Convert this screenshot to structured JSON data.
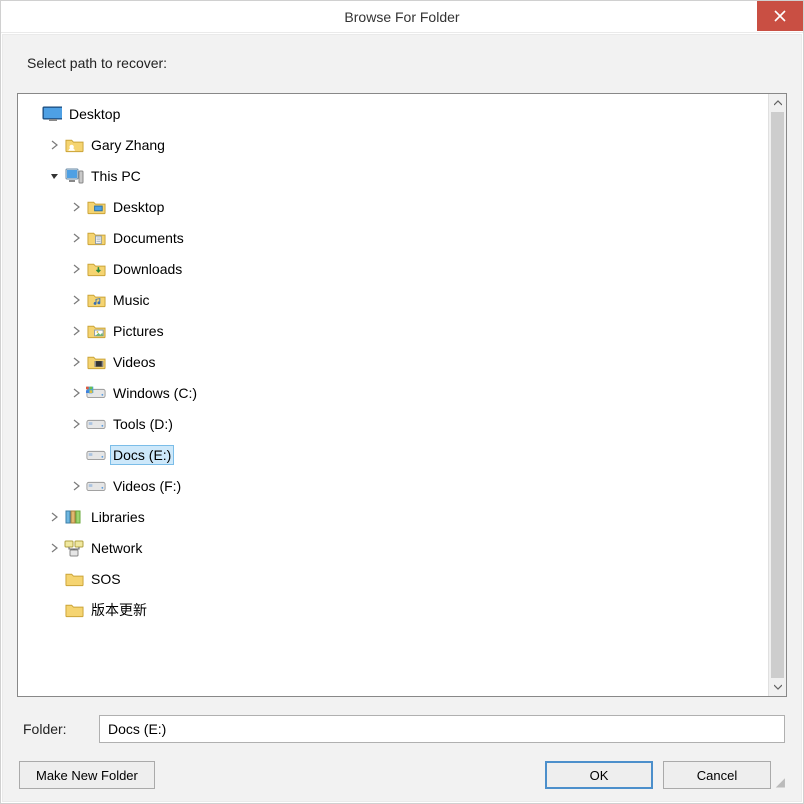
{
  "titlebar": {
    "title": "Browse For Folder"
  },
  "instruction": "Select path to recover:",
  "tree": [
    {
      "label": "Desktop",
      "indent": 0,
      "arrow": "none",
      "icon": "desktop",
      "selected": false
    },
    {
      "label": "Gary Zhang",
      "indent": 1,
      "arrow": "collapsed",
      "icon": "userfolder",
      "selected": false
    },
    {
      "label": "This PC",
      "indent": 1,
      "arrow": "expanded",
      "icon": "pc",
      "selected": false
    },
    {
      "label": "Desktop",
      "indent": 2,
      "arrow": "collapsed",
      "icon": "libfolder-desktop",
      "selected": false
    },
    {
      "label": "Documents",
      "indent": 2,
      "arrow": "collapsed",
      "icon": "libfolder-docs",
      "selected": false
    },
    {
      "label": "Downloads",
      "indent": 2,
      "arrow": "collapsed",
      "icon": "libfolder-down",
      "selected": false
    },
    {
      "label": "Music",
      "indent": 2,
      "arrow": "collapsed",
      "icon": "libfolder-music",
      "selected": false
    },
    {
      "label": "Pictures",
      "indent": 2,
      "arrow": "collapsed",
      "icon": "libfolder-pics",
      "selected": false
    },
    {
      "label": "Videos",
      "indent": 2,
      "arrow": "collapsed",
      "icon": "libfolder-vids",
      "selected": false
    },
    {
      "label": "Windows (C:)",
      "indent": 2,
      "arrow": "collapsed",
      "icon": "drive-win",
      "selected": false
    },
    {
      "label": "Tools (D:)",
      "indent": 2,
      "arrow": "collapsed",
      "icon": "drive",
      "selected": false
    },
    {
      "label": "Docs (E:)",
      "indent": 2,
      "arrow": "none",
      "icon": "drive",
      "selected": true
    },
    {
      "label": "Videos (F:)",
      "indent": 2,
      "arrow": "collapsed",
      "icon": "drive",
      "selected": false
    },
    {
      "label": "Libraries",
      "indent": 1,
      "arrow": "collapsed",
      "icon": "libraries",
      "selected": false
    },
    {
      "label": "Network",
      "indent": 1,
      "arrow": "collapsed",
      "icon": "network",
      "selected": false
    },
    {
      "label": "SOS",
      "indent": 1,
      "arrow": "none",
      "icon": "folder",
      "selected": false
    },
    {
      "label": "版本更新",
      "indent": 1,
      "arrow": "none",
      "icon": "folder",
      "selected": false
    }
  ],
  "folderField": {
    "label": "Folder:",
    "value": "Docs (E:)"
  },
  "buttons": {
    "makeNew": "Make New Folder",
    "ok": "OK",
    "cancel": "Cancel"
  }
}
